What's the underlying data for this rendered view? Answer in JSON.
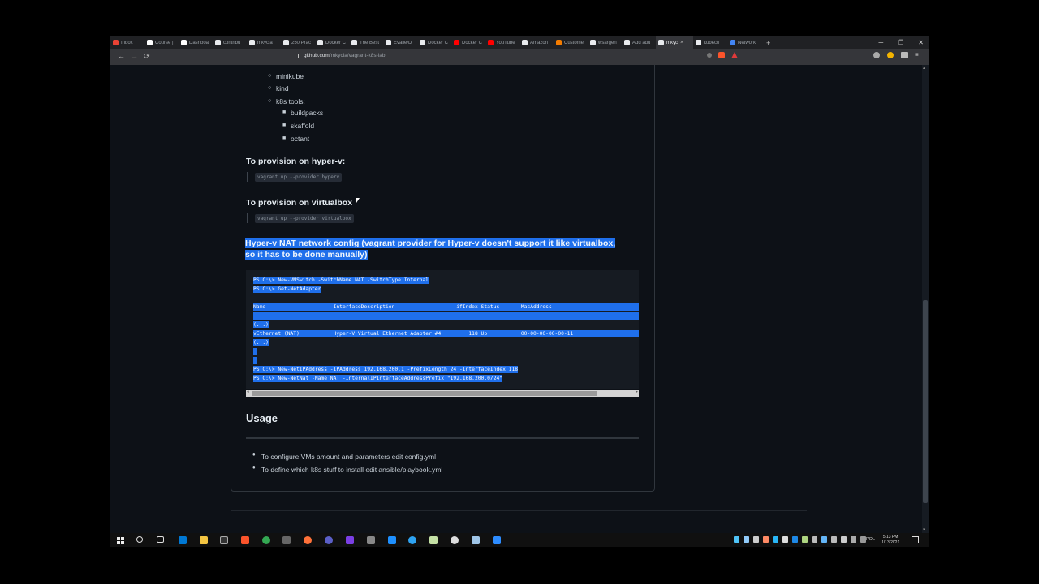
{
  "browser": {
    "tabs": [
      {
        "label": "Inbox",
        "color": "#ea4335"
      },
      {
        "label": "Course |",
        "color": "#ffffff"
      },
      {
        "label": "Dashboa",
        "color": "#ffffff"
      },
      {
        "label": "contribu",
        "color": "#e8eaed"
      },
      {
        "label": "mkycia",
        "color": "#e8eaed"
      },
      {
        "label": "250 Prac",
        "color": "#e8eaed"
      },
      {
        "label": "Docker C",
        "color": "#e8eaed"
      },
      {
        "label": "The Best",
        "color": "#e8eaed"
      },
      {
        "label": "Evalle/D",
        "color": "#e8eaed"
      },
      {
        "label": "Docker C",
        "color": "#e8eaed"
      },
      {
        "label": "Docker C",
        "color": "#ff0000"
      },
      {
        "label": "YouTube",
        "color": "#ff0000"
      },
      {
        "label": "Amazon",
        "color": "#e8eaed"
      },
      {
        "label": "Custome",
        "color": "#f57c00"
      },
      {
        "label": "wsargen",
        "color": "#e8eaed"
      },
      {
        "label": "Add adu",
        "color": "#e8eaed"
      },
      {
        "label": "mkyc",
        "color": "#e8eaed",
        "active": true
      },
      {
        "label": "kubectl",
        "color": "#e8eaed"
      },
      {
        "label": "Network",
        "color": "#4285f4"
      }
    ],
    "new_tab": "+",
    "window_controls": {
      "minimize": "─",
      "restore": "❐",
      "close": "✕"
    },
    "url_host": "github.com",
    "url_path": "/mkycia/vagrant-k8s-lab",
    "back": "←",
    "forward": "→",
    "reload": "⟳"
  },
  "readme": {
    "tools_list": [
      "minikube",
      "kind",
      "k8s tools:"
    ],
    "k8s_tools": [
      "buildpacks",
      "skaffold",
      "octant"
    ],
    "hyperv_heading": "To provision on hyper-v:",
    "hyperv_cmd": "vagrant up --provider hyperv",
    "vbox_heading": "To provision on virtualbox",
    "vbox_cmd": "vagrant up --provider virtualbox",
    "nat_heading_line1": "Hyper-v NAT network config (vagrant provider for Hyper-v doesn't support it like virtualbox,",
    "nat_heading_line2": "so it has to be done manually)",
    "code_lines": [
      "PS C:\\> New-VMSwitch -SwitchName NAT -SwitchType Internal",
      "PS C:\\> Get-NetAdapter",
      "",
      "Name                      InterfaceDescription                    ifIndex Status       MacAddress",
      "----                      --------------------                    ------- ------       ----------",
      "(...)",
      "vEthernet (NAT)           Hyper-V Virtual Ethernet Adapter #4         118 Up           00-00-00-00-00-11",
      "(...)",
      "",
      "",
      "PS C:\\> New-NetIPAddress -IPAddress 192.168.200.1 -PrefixLength 24 -InterfaceIndex 118",
      "PS C:\\> New-NetNat -Name NAT -InternalIPInterfaceAddressPrefix \"192.168.200.0/24\""
    ],
    "usage_heading": "Usage",
    "usage_items": [
      "To configure VMs amount and parameters edit config.yml",
      "To define which k8s stuff to install edit ansible/playbook.yml"
    ]
  },
  "taskbar": {
    "lang": "POL",
    "time": "5:13 PM",
    "date": "1/13/2021"
  }
}
